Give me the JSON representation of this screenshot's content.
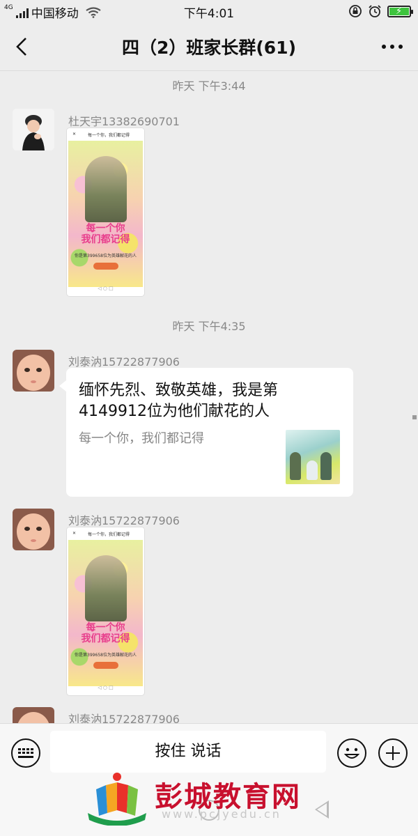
{
  "status_bar": {
    "network": "4G",
    "carrier": "中国移动",
    "time": "下午4:01"
  },
  "header": {
    "title": "四（2）班家长群(61)"
  },
  "messages": [
    {
      "timestamp": "昨天 下午3:44",
      "sender": "杜天宇13382690701",
      "type": "image"
    },
    {
      "timestamp": "昨天 下午4:35",
      "sender": "刘泰汭15722877906",
      "type": "link",
      "link_title": "缅怀先烈、致敬英雄，我是第4149912位为他们献花的人",
      "link_desc": "每一个你，我们都记得"
    },
    {
      "sender": "刘泰汭15722877906",
      "type": "image"
    },
    {
      "sender": "刘泰汭15722877906",
      "type": "image"
    }
  ],
  "poster": {
    "heading": "每一个你，我们都记得",
    "slogan_line1": "每一个你",
    "slogan_line2": "我们都记得",
    "sub": "你是第399658位为英雄献花的人"
  },
  "input_bar": {
    "talk_label": "按住 说话"
  },
  "watermark": {
    "text": "彭城教育网",
    "url": "www.pcjyedu.cn"
  },
  "colors": {
    "background": "#ededed",
    "bubble": "#ffffff",
    "watermark_red": "#c8102e",
    "battery_green": "#3ec43e"
  },
  "icons": [
    "back-chevron-icon",
    "more-icon",
    "keyboard-icon",
    "emoji-icon",
    "plus-icon",
    "home-nav-icon",
    "back-nav-icon"
  ]
}
